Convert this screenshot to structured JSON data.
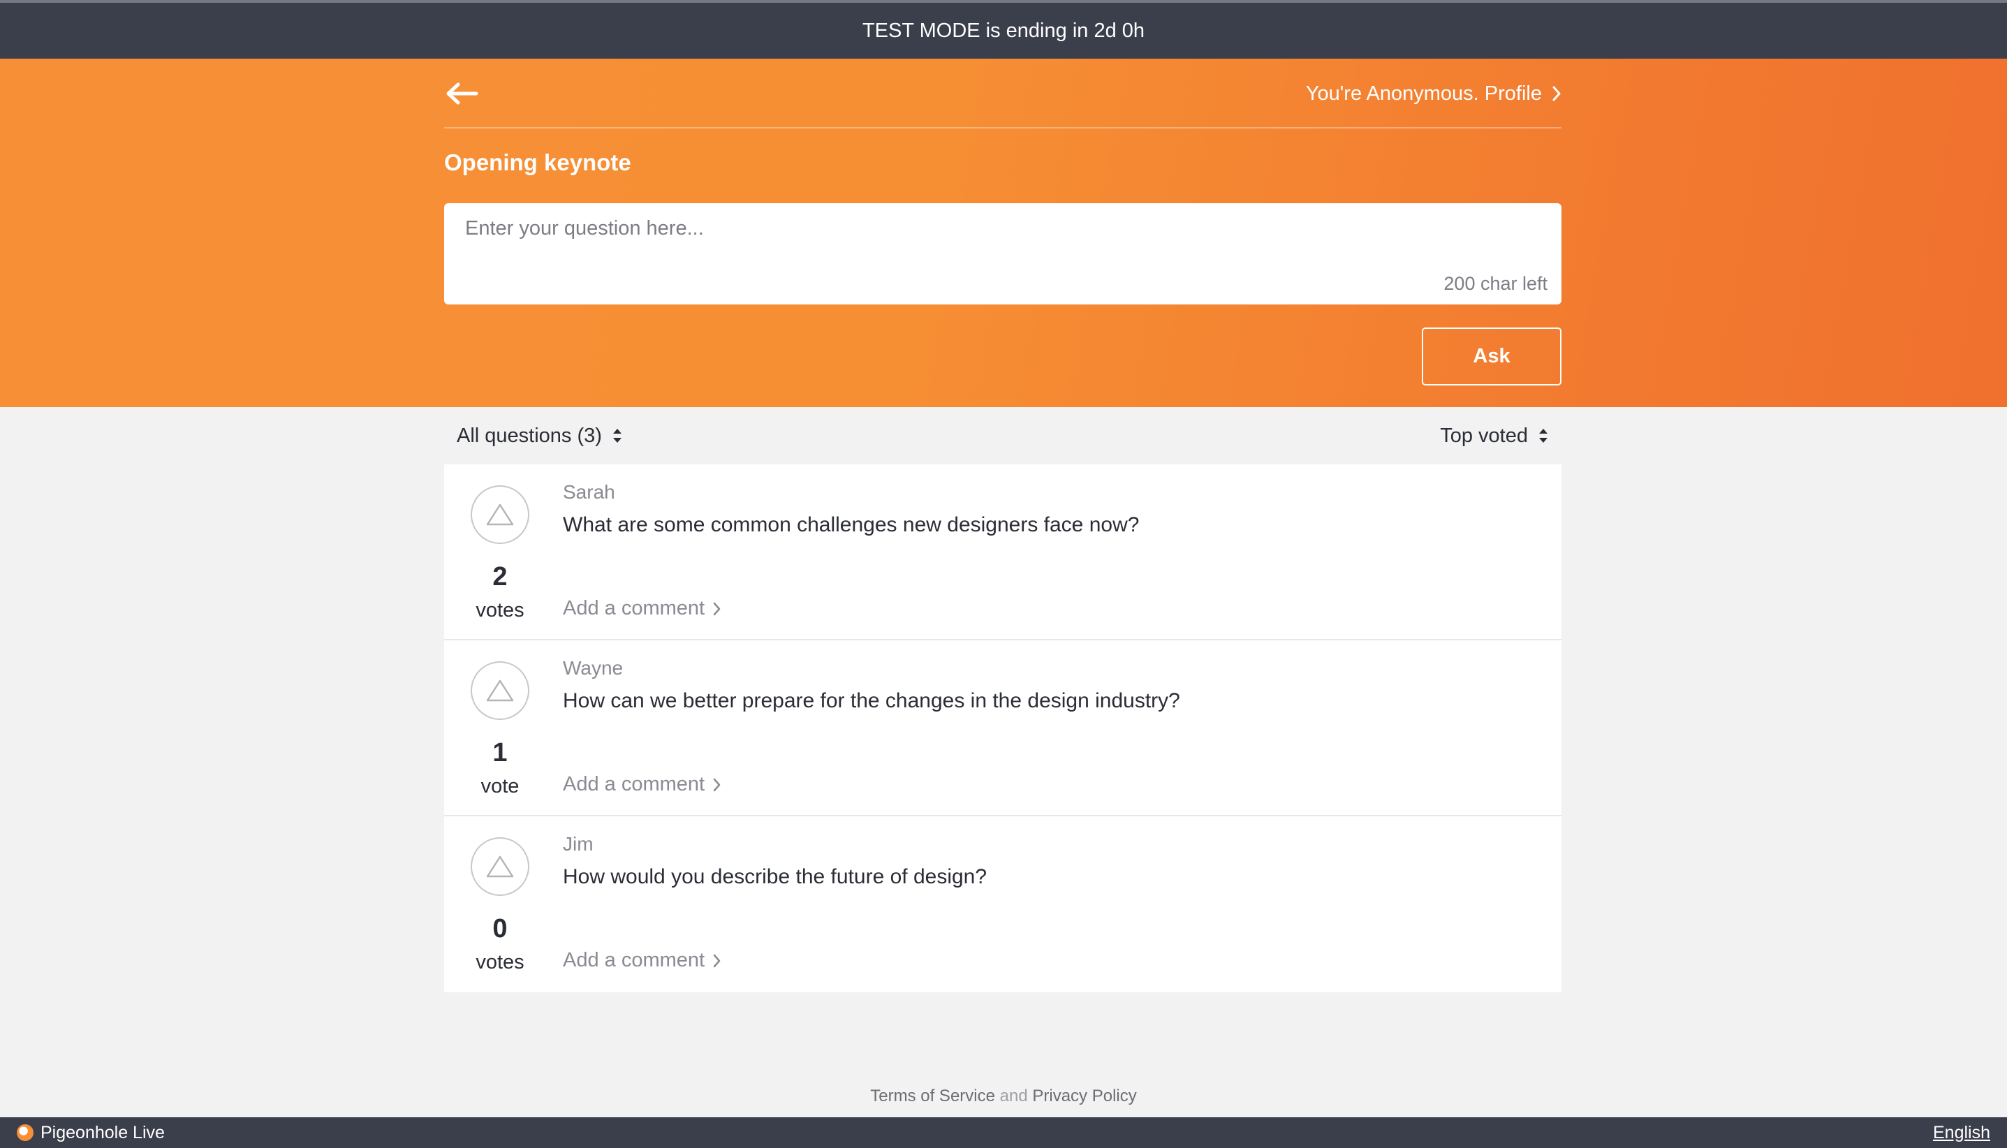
{
  "banner": {
    "text": "TEST MODE is ending in 2d 0h"
  },
  "header": {
    "profile_label": "You're Anonymous. Profile",
    "session_title": "Opening keynote"
  },
  "ask_form": {
    "placeholder": "Enter your question here...",
    "value": "",
    "char_left": "200 char left",
    "submit_label": "Ask"
  },
  "filters": {
    "question_filter": "All questions (3)",
    "sort": "Top voted"
  },
  "questions": [
    {
      "author": "Sarah",
      "text": "What are some common challenges new designers face now?",
      "votes": "2",
      "votes_label": "votes",
      "comment_label": "Add a comment"
    },
    {
      "author": "Wayne",
      "text": "How can we better prepare for the changes in the design industry?",
      "votes": "1",
      "votes_label": "vote",
      "comment_label": "Add a comment"
    },
    {
      "author": "Jim",
      "text": "How would you describe the future of design?",
      "votes": "0",
      "votes_label": "votes",
      "comment_label": "Add a comment"
    }
  ],
  "footer": {
    "terms": "Terms of Service",
    "and": "and",
    "privacy": "Privacy Policy",
    "brand": "Pigeonhole Live",
    "language": "English"
  },
  "colors": {
    "accent": "#f68f36",
    "dark_bar": "#3b3e4b",
    "background": "#f2f2f2"
  }
}
